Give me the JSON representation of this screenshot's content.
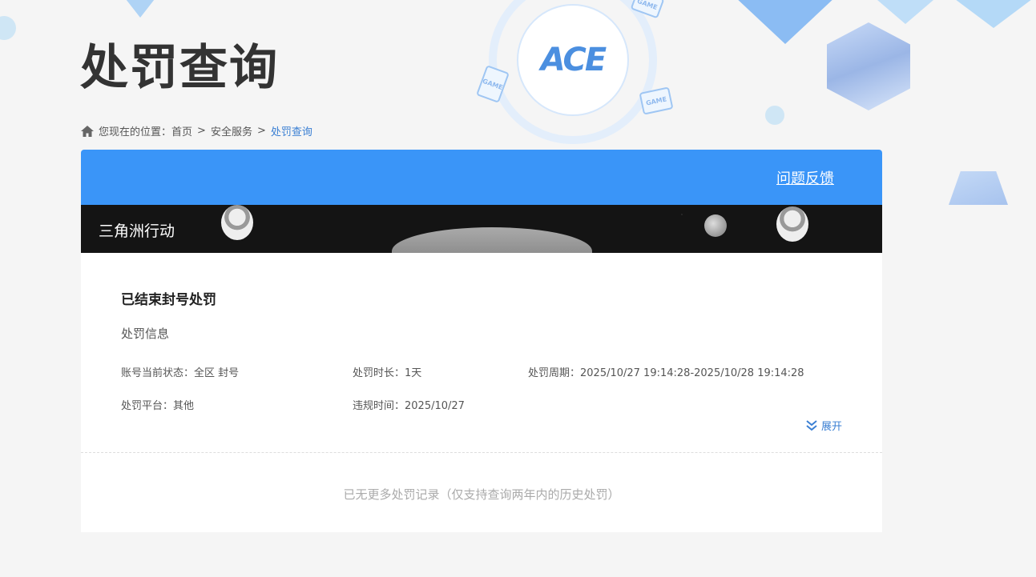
{
  "page": {
    "title": "处罚查询"
  },
  "breadcrumb": {
    "prefix": "您现在的位置：",
    "home": "首页",
    "sep": ">",
    "section": "安全服务",
    "current": "处罚查询"
  },
  "header": {
    "feedback": "问题反馈"
  },
  "logo": {
    "text": "ACE"
  },
  "game": {
    "name": "三角洲行动"
  },
  "record": {
    "status_title": "已结束封号处罚",
    "section_label": "处罚信息",
    "account_status": "账号当前状态：全区 封号",
    "duration": "处罚时长：1天",
    "period": "处罚周期：2025/10/27 19:14:28-2025/10/28 19:14:28",
    "platform": "处罚平台：其他",
    "violation_time": "违规时间：2025/10/27",
    "expand_label": "展开"
  },
  "footer": {
    "no_more": "已无更多处罚记录（仅支持查询两年内的历史处罚）"
  },
  "decor": {
    "game_card_label": "GAME"
  },
  "colors": {
    "primary": "#3a95f8",
    "link": "#3a7fd3"
  }
}
